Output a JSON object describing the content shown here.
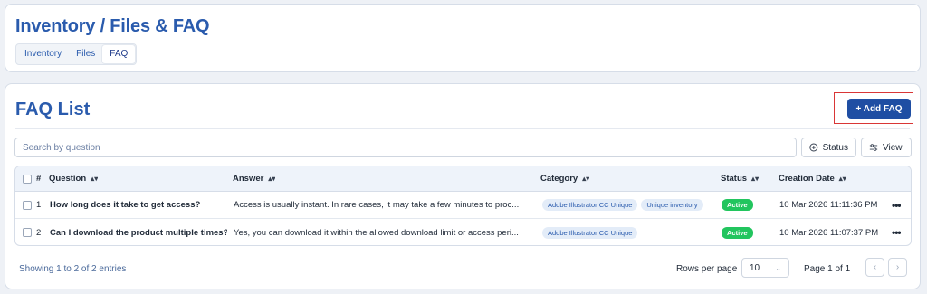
{
  "header": {
    "title": "Inventory / Files & FAQ",
    "tabs": [
      {
        "label": "Inventory"
      },
      {
        "label": "Files"
      },
      {
        "label": "FAQ"
      }
    ]
  },
  "list": {
    "title": "FAQ List",
    "add_button_label": "+ Add FAQ",
    "search_placeholder": "Search by question",
    "status_button_label": "Status",
    "view_button_label": "View"
  },
  "table": {
    "columns": {
      "index": "#",
      "question": "Question",
      "answer": "Answer",
      "category": "Category",
      "status": "Status",
      "created": "Creation Date"
    },
    "rows": [
      {
        "index": "1",
        "question": "How long does it take to get access?",
        "answer": "Access is usually instant. In rare cases, it may take a few minutes to proc...",
        "categories": [
          "Adobe Illustrator CC Unique",
          "Unique inventory"
        ],
        "status": "Active",
        "created": "10 Mar 2026 11:11:36 PM"
      },
      {
        "index": "2",
        "question": "Can I download the product multiple times?",
        "answer": "Yes, you can download it within the allowed download limit or access peri...",
        "categories": [
          "Adobe Illustrator CC Unique"
        ],
        "status": "Active",
        "created": "10 Mar 2026 11:07:37 PM"
      }
    ]
  },
  "footer": {
    "showing": "Showing 1 to 2 of 2 entries",
    "rows_per_page_label": "Rows per page",
    "rows_per_page_value": "10",
    "page_info": "Page 1 of 1"
  },
  "colors": {
    "title": "#2a5bad",
    "primary_button": "#1f4ea3",
    "active_badge": "#22c55e",
    "highlight_border": "#d93636"
  }
}
